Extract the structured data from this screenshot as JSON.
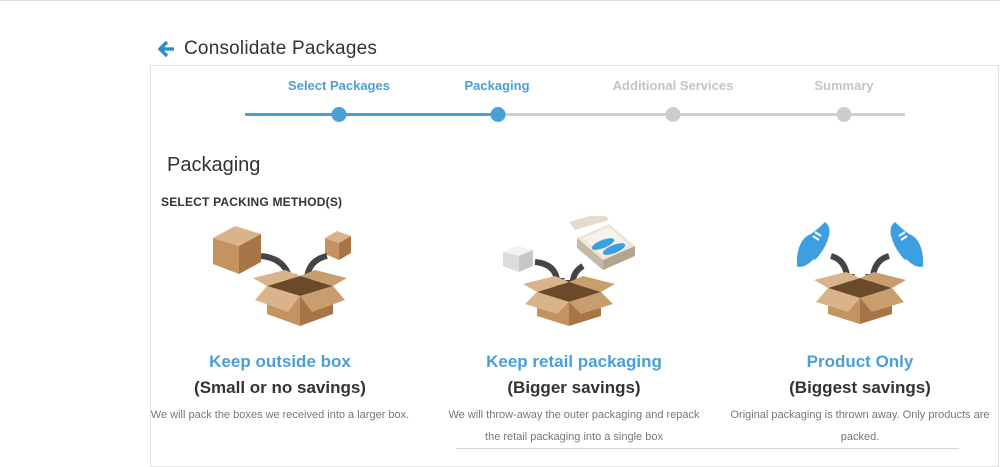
{
  "header": {
    "title": "Consolidate Packages",
    "back_icon": "arrow-left-icon"
  },
  "colors": {
    "accent": "#4a9fd6",
    "inactive": "#cdcdcd",
    "text": "#333333"
  },
  "steps": [
    {
      "label": "Select Packages",
      "status": "done"
    },
    {
      "label": "Packaging",
      "status": "current"
    },
    {
      "label": "Additional Services",
      "status": "todo"
    },
    {
      "label": "Summary",
      "status": "todo"
    }
  ],
  "section": {
    "title": "Packaging",
    "subtitle": "SELECT PACKING METHOD(S)"
  },
  "options": [
    {
      "title": "Keep outside box",
      "subtitle": "(Small or no savings)",
      "description": "We will pack the boxes we received into a larger box.",
      "icon": "boxes-into-box-icon"
    },
    {
      "title": "Keep retail packaging",
      "subtitle": "(Bigger savings)",
      "description": "We will throw-away the outer packaging and repack the retail packaging into a single box",
      "icon": "shoebox-into-box-icon"
    },
    {
      "title": "Product Only",
      "subtitle": "(Biggest savings)",
      "description": "Original packaging is thrown away. Only products are packed.",
      "icon": "shoes-into-box-icon"
    }
  ]
}
